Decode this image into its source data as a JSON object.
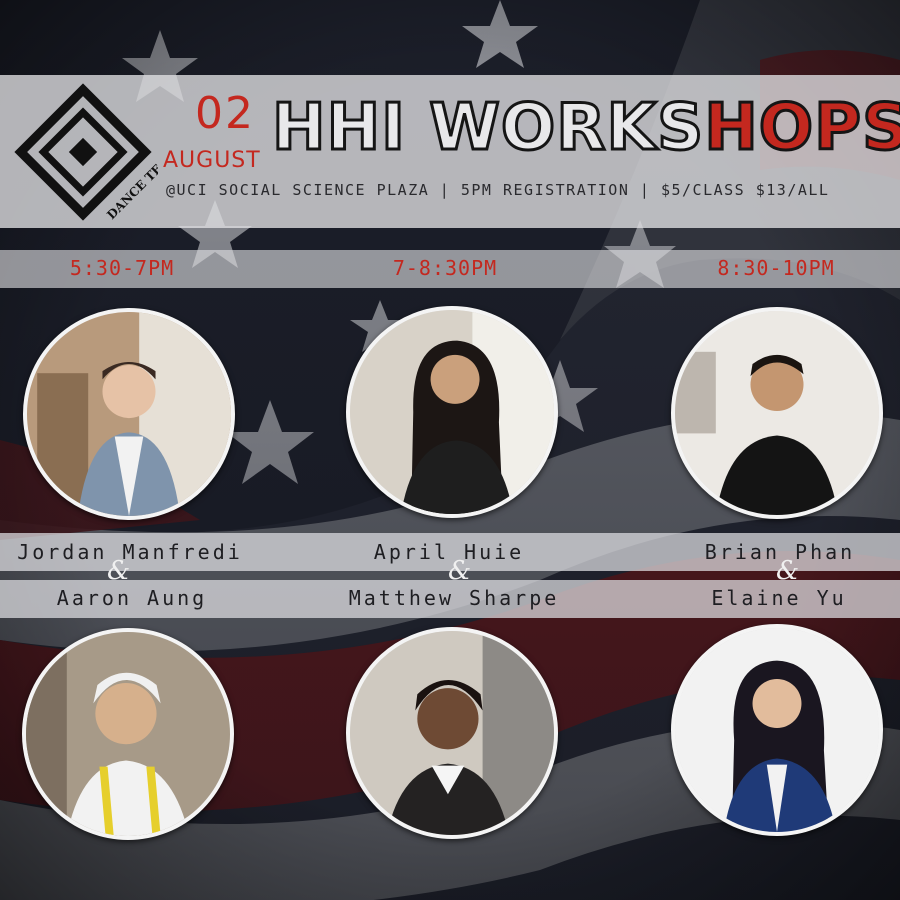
{
  "header": {
    "logo_text": "DANCE TEAM",
    "date_day": "02",
    "date_month": "AUGUST",
    "title_main": "HHI WORKS",
    "title_accent": "HOPS",
    "subtitle": "@UCI SOCIAL SCIENCE PLAZA | 5PM REGISTRATION | $5/CLASS $13/ALL"
  },
  "schedule": {
    "times": [
      "5:30-7PM",
      "7-8:30PM",
      "8:30-10PM"
    ],
    "slots": [
      {
        "name_a": "Jordan Manfredi",
        "name_b": "Aaron Aung"
      },
      {
        "name_a": "April Huie",
        "name_b": "Matthew Sharpe"
      },
      {
        "name_a": "Brian Phan",
        "name_b": "Elaine Yu"
      }
    ],
    "amp": "&"
  },
  "colors": {
    "accent": "#c4281f",
    "band": "#e1e1e4",
    "dark": "#151515"
  }
}
